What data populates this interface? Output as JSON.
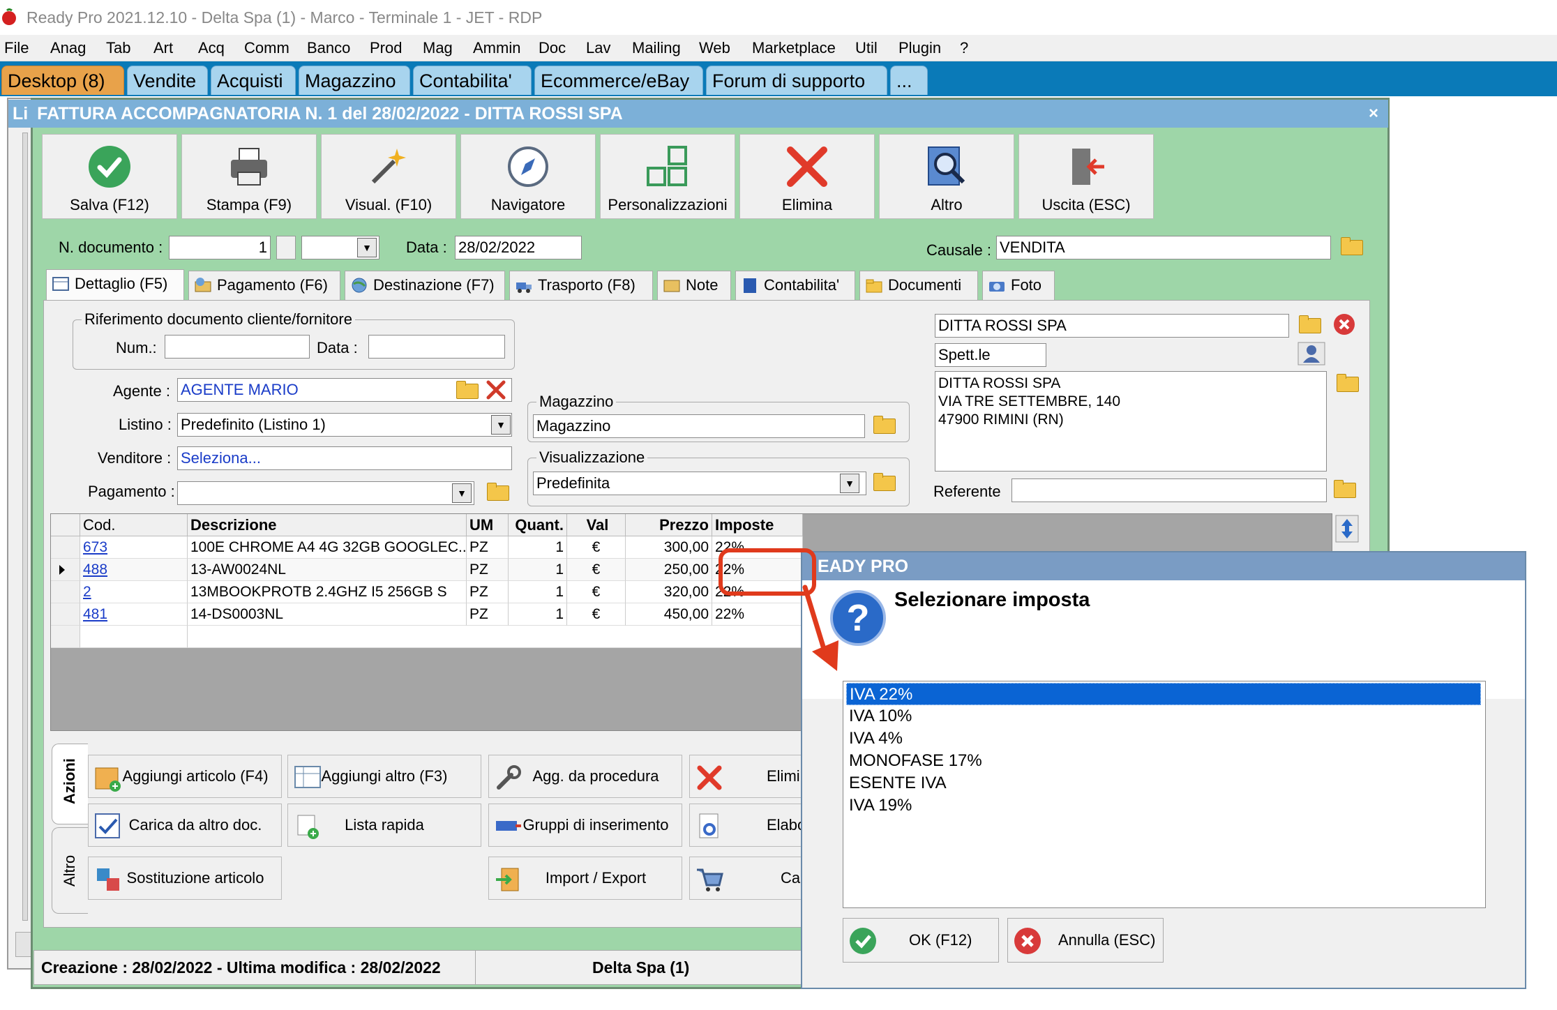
{
  "window_title": "Ready Pro 2021.12.10 - Delta Spa (1) - Marco - Terminale 1 - JET - RDP",
  "menu": [
    "File",
    "Anag",
    "Tab",
    "Art",
    "Acq",
    "Comm",
    "Banco",
    "Prod",
    "Mag",
    "Ammin",
    "Doc",
    "Lav",
    "Mailing",
    "Web",
    "Marketplace",
    "Util",
    "Plugin",
    "?"
  ],
  "main_tabs": [
    "Desktop (8)",
    "Vendite",
    "Acquisti",
    "Magazzino",
    "Contabilita'",
    "Ecommerce/eBay",
    "Forum di supporto",
    "..."
  ],
  "doc_window": {
    "title_prefix": "Li",
    "title": "FATTURA ACCOMPAGNATORIA N. 1 del 28/02/2022 - DITTA ROSSI SPA",
    "close": "×"
  },
  "toolbar": [
    "Salva (F12)",
    "Stampa (F9)",
    "Visual. (F10)",
    "Navigatore",
    "Personalizzazioni",
    "Elimina",
    "Altro",
    "Uscita (ESC)"
  ],
  "header": {
    "ndoc_label": "N. documento :",
    "ndoc_value": "1",
    "data_label": "Data :",
    "data_value": "28/02/2022",
    "causale_label": "Causale :",
    "causale_value": "VENDITA"
  },
  "inner_tabs": [
    "Dettaglio (F5)",
    "Pagamento (F6)",
    "Destinazione (F7)",
    "Trasporto (F8)",
    "Note",
    "Contabilita'",
    "Documenti",
    "Foto"
  ],
  "riferimento": {
    "group_title": "Riferimento documento cliente/fornitore",
    "num_label": "Num.:",
    "data_label": "Data :"
  },
  "fields": {
    "agente_label": "Agente :",
    "agente_value": "AGENTE MARIO",
    "listino_label": "Listino :",
    "listino_value": "Predefinito (Listino 1)",
    "venditore_label": "Venditore :",
    "venditore_value": "Seleziona...",
    "pagamento_label": "Pagamento :",
    "pagamento_value": ""
  },
  "magazzino": {
    "group_title": "Magazzino",
    "value": "Magazzino"
  },
  "visualizzazione": {
    "group_title": "Visualizzazione",
    "value": "Predefinita"
  },
  "cliente": {
    "name": "DITTA ROSSI SPA",
    "salutation": "Spett.le",
    "address_lines": [
      "DITTA ROSSI SPA",
      "VIA TRE SETTEMBRE, 140",
      "47900 RIMINI (RN)"
    ],
    "referente_label": "Referente"
  },
  "grid": {
    "columns": [
      "Cod.",
      "Descrizione",
      "UM",
      "Quant.",
      "Val",
      "Prezzo",
      "Imposte"
    ],
    "rows": [
      [
        "673",
        "100E CHROME A4 4G 32GB GOOGLEC...",
        "PZ",
        "1",
        "€",
        "300,00",
        "22%"
      ],
      [
        "488",
        "13-AW0024NL",
        "PZ",
        "1",
        "€",
        "250,00",
        "22%"
      ],
      [
        "2",
        "13MBOOKPROTB 2.4GHZ I5 256GB S",
        "PZ",
        "1",
        "€",
        "320,00",
        "22%"
      ],
      [
        "481",
        "14-DS0003NL",
        "PZ",
        "1",
        "€",
        "450,00",
        "22%"
      ]
    ]
  },
  "side_tabs": [
    "Azioni",
    "Altro"
  ],
  "actions": [
    "Aggiungi articolo (F4)",
    "Aggiungi altro (F3)",
    "Agg. da procedura",
    "Elimir",
    "Carica da altro doc.",
    "Lista rapida",
    "Gruppi di inserimento",
    "Elabo",
    "Sostituzione articolo",
    "Import / Export",
    "Ca"
  ],
  "status": {
    "left": "Creazione : 28/02/2022 - Ultima modifica : 28/02/2022",
    "right": "Delta Spa (1)"
  },
  "dialog": {
    "title": "EADY PRO",
    "question": "Selezionare imposta",
    "options": [
      "IVA 22%",
      "IVA 10%",
      "IVA 4%",
      "MONOFASE 17%",
      "ESENTE IVA",
      "IVA 19%"
    ],
    "ok": "OK (F12)",
    "cancel": "Annulla (ESC)"
  },
  "colors": {
    "window_green": "#9ed6a8",
    "tab_blue": "#0a7ab8",
    "active_tab": "#e8a24a",
    "selection": "#0a64d4",
    "highlight_red": "#e03a1c"
  }
}
